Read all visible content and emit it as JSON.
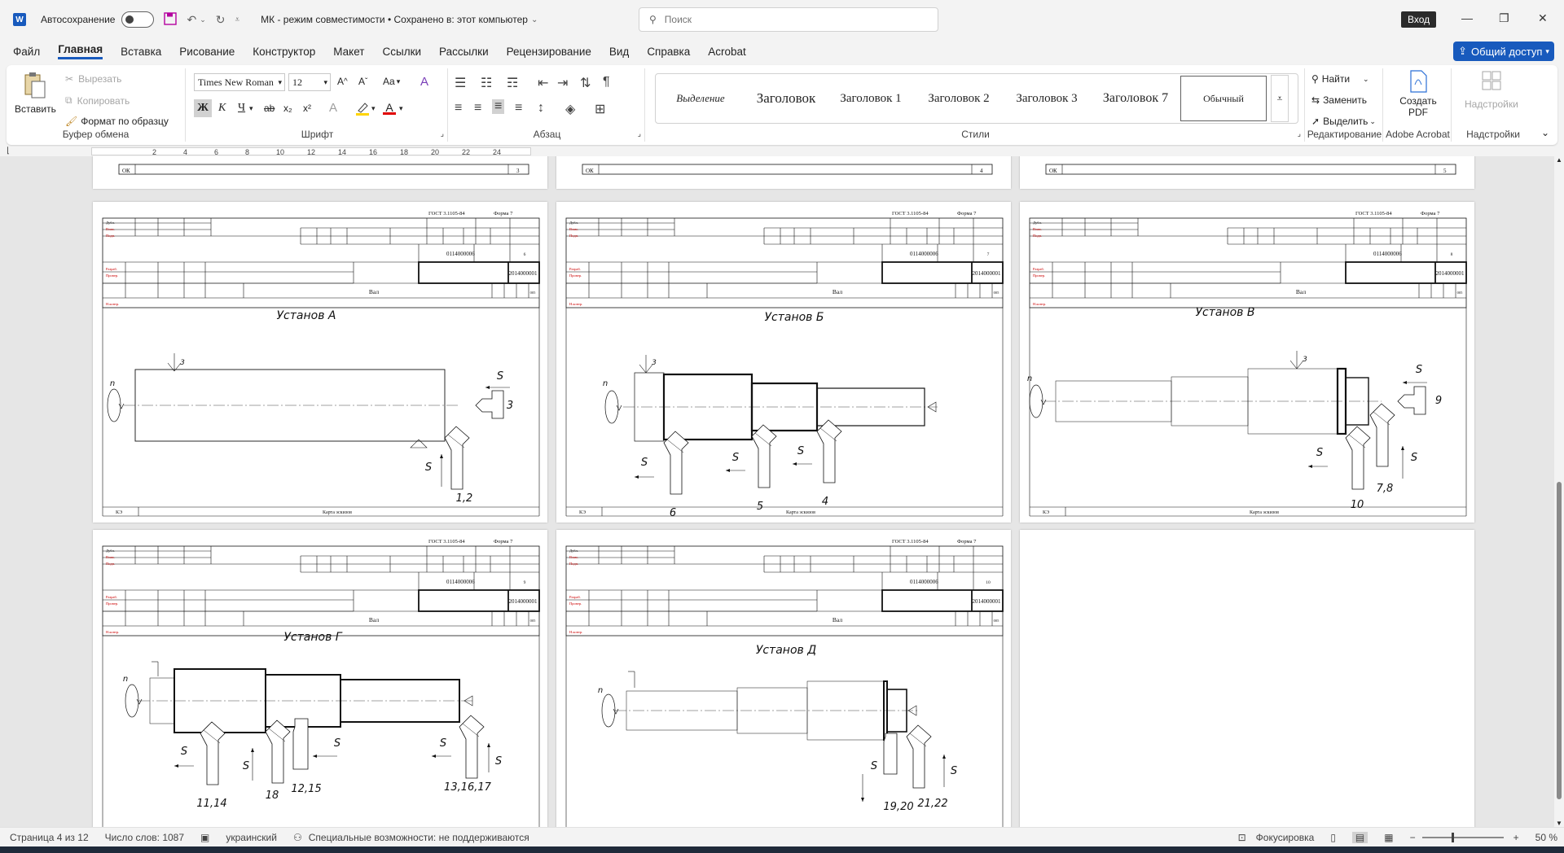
{
  "titlebar": {
    "app_icon": "word-icon",
    "autosave_label": "Автосохранение",
    "document_title": "МК  -  режим совместимости  •  Сохранено в: этот компьютер",
    "search_placeholder": "Поиск",
    "signin_label": "Вход"
  },
  "tabs": [
    "Файл",
    "Главная",
    "Вставка",
    "Рисование",
    "Конструктор",
    "Макет",
    "Ссылки",
    "Рассылки",
    "Рецензирование",
    "Вид",
    "Справка",
    "Acrobat"
  ],
  "active_tab": "Главная",
  "share_label": "Общий доступ",
  "ribbon": {
    "clipboard": {
      "label": "Буфер обмена",
      "paste": "Вставить",
      "cut": "Вырезать",
      "copy": "Копировать",
      "format_painter": "Формат по образцу"
    },
    "font": {
      "label": "Шрифт",
      "family": "Times New Roman",
      "size": "12",
      "case": "Aa",
      "bold": "Ж",
      "italic": "К",
      "underline": "Ч",
      "strike": "ab",
      "subscript": "x₂",
      "superscript": "x²"
    },
    "paragraph": {
      "label": "Абзац"
    },
    "styles": {
      "label": "Стили",
      "items": [
        "Выделение",
        "Заголовок",
        "Заголовок 1",
        "Заголовок 2",
        "Заголовок 3",
        "Заголовок 7",
        "Обычный"
      ],
      "selected": "Обычный"
    },
    "editing": {
      "label": "Редактирование",
      "find": "Найти",
      "replace": "Заменить",
      "select": "Выделить"
    },
    "acrobat": {
      "label": "Adobe Acrobat",
      "create_pdf": "Создать PDF"
    },
    "addins": {
      "label": "Надстройки",
      "button": "Надстройки"
    }
  },
  "ruler": {
    "numbers": [
      "2",
      "4",
      "6",
      "8",
      "10",
      "12",
      "14",
      "16",
      "18",
      "20",
      "22",
      "24"
    ]
  },
  "document": {
    "top_strip_pages": [
      "3",
      "4",
      "5"
    ],
    "top_strip_label": "ОК",
    "form": {
      "gost": "ГОСТ 3.1105-84",
      "forma": "Форма 7",
      "code1": "0114000006",
      "code2": "2014000001",
      "part": "Вал",
      "op": "005",
      "footer_left": "КЭ",
      "footer_center": "Карта эскизов",
      "rows_top": [
        "Дубл.",
        "Взам.",
        "Подп."
      ],
      "rows_mid": [
        "Разраб.",
        "Провер."
      ],
      "row_bottom": "Н.контр."
    },
    "pages": [
      {
        "title": "Установ А",
        "num": "6",
        "labels": [
          "n",
          "3",
          "S",
          "3",
          "S",
          "1,2"
        ]
      },
      {
        "title": "Установ Б",
        "num": "7",
        "labels": [
          "n",
          "3",
          "S",
          "6",
          "S",
          "5",
          "S",
          "4"
        ]
      },
      {
        "title": "Установ В",
        "num": "8",
        "labels": [
          "n",
          "3",
          "S",
          "9",
          "S",
          "10",
          "S",
          "7,8"
        ]
      },
      {
        "title": "Установ Г",
        "num": "9",
        "labels": [
          "n",
          "S",
          "11,14",
          "S",
          "18",
          "S",
          "12,15",
          "S",
          "S",
          "13,16,17"
        ]
      },
      {
        "title": "Установ Д",
        "num": "10",
        "labels": [
          "n",
          "S",
          "19,20",
          "S",
          "21,22"
        ]
      }
    ]
  },
  "status": {
    "page": "Страница 4 из 12",
    "words": "Число слов: 1087",
    "language": "украинский",
    "accessibility": "Специальные возможности: не поддерживаются",
    "focus": "Фокусировка",
    "zoom": "50 %"
  }
}
